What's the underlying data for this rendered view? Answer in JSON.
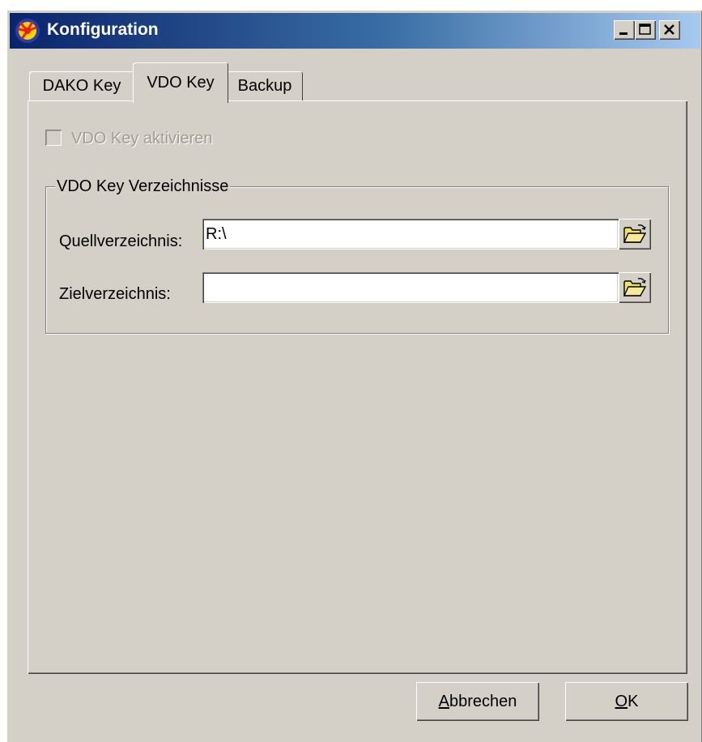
{
  "window": {
    "title": "Konfiguration",
    "icon": "app-sun-icon",
    "controls": [
      "minimize-icon",
      "maximize-icon",
      "close-icon"
    ]
  },
  "tabs": [
    {
      "label": "DAKO Key",
      "selected": false
    },
    {
      "label": "VDO Key",
      "selected": true
    },
    {
      "label": "Backup",
      "selected": false
    }
  ],
  "vdo": {
    "activate_label": "VDO Key aktivieren",
    "activate_checked": false,
    "activate_enabled": false,
    "group_title": "VDO Key Verzeichnisse",
    "source": {
      "label": "Quellverzeichnis:",
      "value": "R:\\",
      "browse_icon": "folder-open-icon"
    },
    "target": {
      "label": "Zielverzeichnis:",
      "value": "",
      "browse_icon": "folder-open-icon"
    }
  },
  "buttons": {
    "cancel": {
      "mnemonic": "A",
      "rest": "bbrechen"
    },
    "ok": {
      "mnemonic": "O",
      "rest": "K"
    }
  },
  "colors": {
    "face": "#d4d0c8",
    "title_start": "#0a246a",
    "title_end": "#a6caf0",
    "disabled_text": "#a09c94"
  }
}
